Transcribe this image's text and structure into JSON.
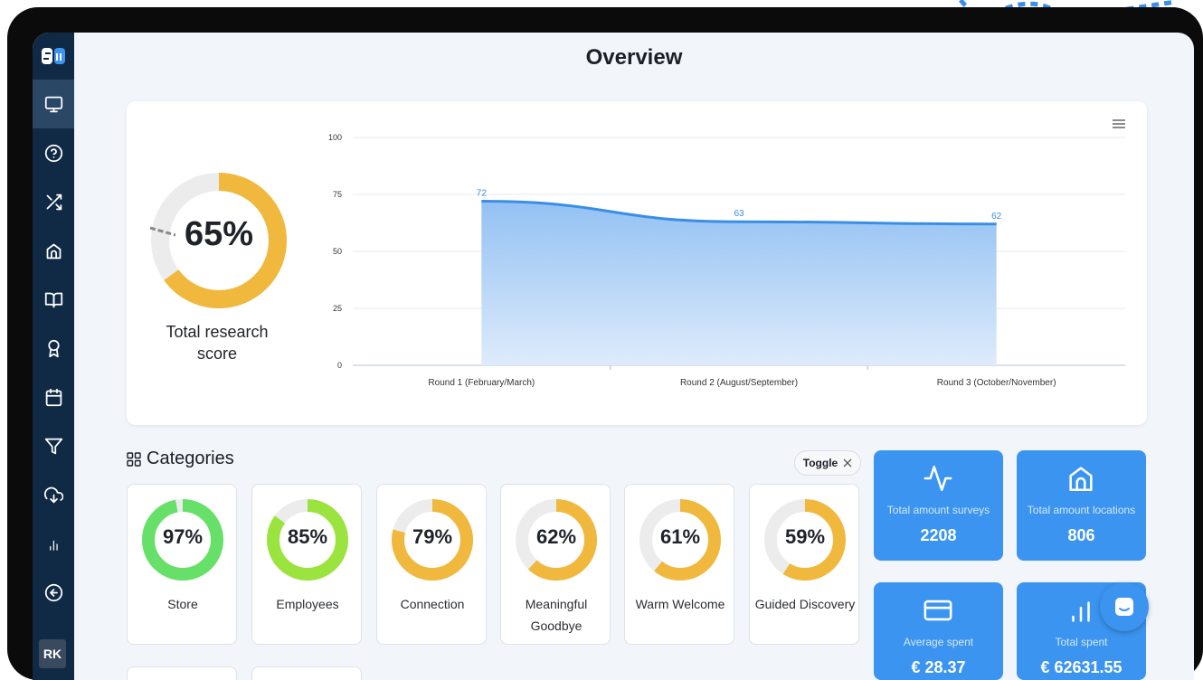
{
  "page": {
    "title": "Overview"
  },
  "sidebar": {
    "logo": "SW",
    "items": [
      {
        "icon": "monitor-icon",
        "active": true
      },
      {
        "icon": "help-circle-icon",
        "active": false
      },
      {
        "icon": "shuffle-icon",
        "active": false
      },
      {
        "icon": "home-icon",
        "active": false
      },
      {
        "icon": "book-open-icon",
        "active": false
      },
      {
        "icon": "award-icon",
        "active": false
      },
      {
        "icon": "calendar-icon",
        "active": false
      },
      {
        "icon": "filter-icon",
        "active": false
      },
      {
        "icon": "download-cloud-icon",
        "active": false
      },
      {
        "icon": "bar-chart-icon",
        "active": false
      },
      {
        "icon": "arrow-left-circle-icon",
        "active": false
      }
    ],
    "user_initials": "RK"
  },
  "score": {
    "value": "65%",
    "fraction": 0.65,
    "label": "Total research score"
  },
  "chart_data": {
    "type": "area",
    "categories": [
      "Round 1 (February/March)",
      "Round 2 (August/September)",
      "Round 3 (October/November)"
    ],
    "series": [
      {
        "values": [
          72,
          63,
          62
        ]
      }
    ],
    "data_labels": [
      "72",
      "63",
      "62"
    ],
    "yticks": [
      "0",
      "25",
      "50",
      "75",
      "100"
    ],
    "ylim": [
      0,
      100
    ],
    "grid": true,
    "color": "#3a8ee6"
  },
  "categories": {
    "title": "Categories",
    "toggle_label": "Toggle",
    "items": [
      {
        "pct": "97%",
        "value": 97,
        "name": "Store",
        "color": "#66e068"
      },
      {
        "pct": "85%",
        "value": 85,
        "name": "Employees",
        "color": "#9be33f"
      },
      {
        "pct": "79%",
        "value": 79,
        "name": "Connection",
        "color": "#f0b83d"
      },
      {
        "pct": "62%",
        "value": 62,
        "name": "Meaningful Goodbye",
        "color": "#f0b83d"
      },
      {
        "pct": "61%",
        "value": 61,
        "name": "Warm Welcome",
        "color": "#f0b83d"
      },
      {
        "pct": "59%",
        "value": 59,
        "name": "Guided Discovery",
        "color": "#f0b83d"
      }
    ]
  },
  "stats": [
    {
      "icon": "activity-icon",
      "label": "Total amount surveys",
      "value": "2208"
    },
    {
      "icon": "home-icon",
      "label": "Total amount locations",
      "value": "806"
    },
    {
      "icon": "credit-card-icon",
      "label": "Average spent",
      "value": "€ 28.37"
    },
    {
      "icon": "bar-chart-icon",
      "label": "Total spent",
      "value": "€ 62631.55"
    }
  ],
  "colors": {
    "sidebar": "#102a45",
    "accent": "#3b94f0",
    "score_ring": "#f0b83d",
    "ring_track": "#ececec"
  }
}
